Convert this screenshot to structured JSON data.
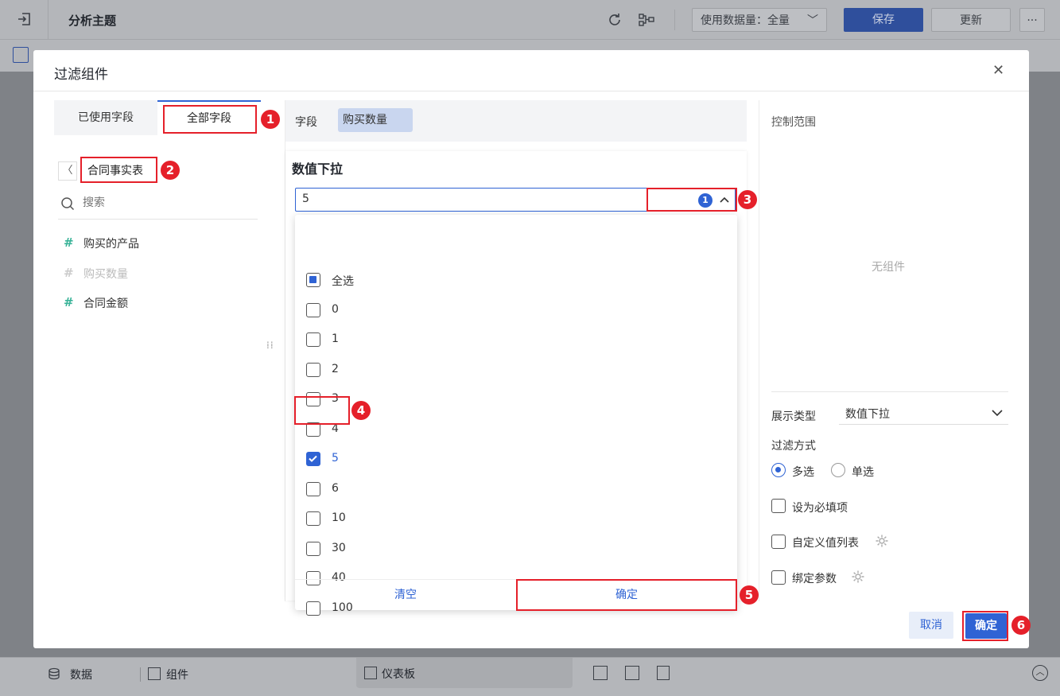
{
  "topbar": {
    "title": "分析主题",
    "data_volume_label": "使用数据量：全量",
    "save_label": "保存",
    "update_label": "更新",
    "more_label": "···"
  },
  "bottombar": {
    "data_label": "数据",
    "component_label": "组件",
    "dashboard_label": "仪表板"
  },
  "dialog": {
    "title": "过滤组件",
    "close_label": "✕",
    "left": {
      "tabs": [
        "已使用字段",
        "全部字段"
      ],
      "table_name": "合同事实表",
      "search_placeholder": "搜索",
      "fields": [
        {
          "label": "购买的产品",
          "disabled": false
        },
        {
          "label": "购买数量",
          "disabled": true
        },
        {
          "label": "合同金额",
          "disabled": false
        }
      ]
    },
    "middle": {
      "field_label": "字段",
      "field_chip": "购买数量",
      "widget_title": "数值下拉",
      "input_value": "5",
      "selected_count": "1",
      "options": [
        {
          "label": "全选",
          "state": "partial"
        },
        {
          "label": "0",
          "state": "unchecked"
        },
        {
          "label": "1",
          "state": "unchecked"
        },
        {
          "label": "2",
          "state": "unchecked"
        },
        {
          "label": "3",
          "state": "unchecked"
        },
        {
          "label": "4",
          "state": "unchecked"
        },
        {
          "label": "5",
          "state": "checked"
        },
        {
          "label": "6",
          "state": "unchecked"
        },
        {
          "label": "10",
          "state": "unchecked"
        },
        {
          "label": "30",
          "state": "unchecked"
        },
        {
          "label": "40",
          "state": "unchecked"
        },
        {
          "label": "100",
          "state": "unchecked"
        }
      ],
      "clear_label": "清空",
      "confirm_label": "确定"
    },
    "right": {
      "control_scope_label": "控制范围",
      "no_component_label": "无组件",
      "display_type_label": "展示类型",
      "display_type_value": "数值下拉",
      "filter_mode_label": "过滤方式",
      "multi_label": "多选",
      "single_label": "单选",
      "required_label": "设为必填项",
      "custom_list_label": "自定义值列表",
      "bind_param_label": "绑定参数"
    },
    "footer": {
      "cancel_label": "取消",
      "ok_label": "确定"
    }
  },
  "annotations": [
    "1",
    "2",
    "3",
    "4",
    "5",
    "6"
  ],
  "colors": {
    "primary": "#2f63d4",
    "annotation": "#e5202a",
    "field_icon": "#3ab398"
  }
}
